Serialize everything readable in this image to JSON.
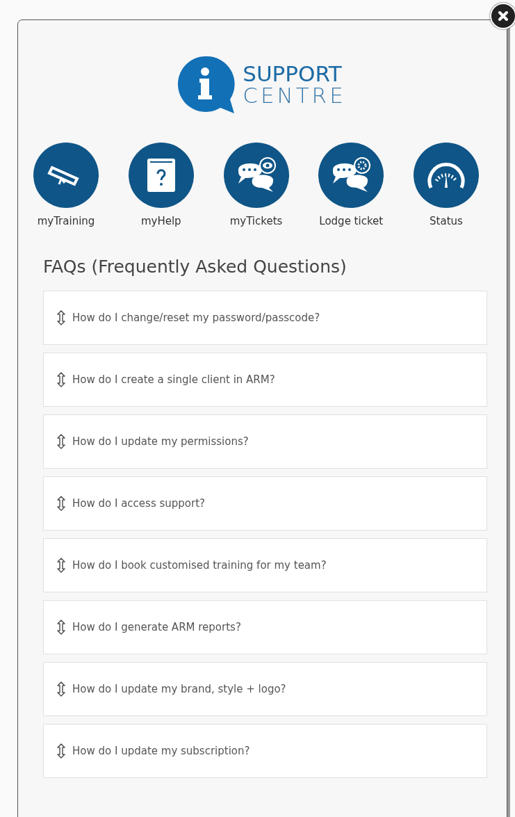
{
  "logo": {
    "line_1": "SUPPORT",
    "line_2": "CENTRE"
  },
  "shortcuts": [
    {
      "kind": "training",
      "label": "myTraining"
    },
    {
      "kind": "help",
      "label": "myHelp"
    },
    {
      "kind": "tickets",
      "label": "myTickets"
    },
    {
      "kind": "lodge",
      "label": "Lodge ticket"
    },
    {
      "kind": "status",
      "label": "Status"
    }
  ],
  "faq": {
    "title": "FAQs (Frequently Asked Questions)",
    "items": [
      "How do I change/reset my password/passcode?",
      "How do I create a single client in ARM?",
      "How do I update my permissions?",
      "How do I access support?",
      "How do I book customised training for my team?",
      "How do I generate ARM reports?",
      "How do I update my brand, style + logo?",
      "How do I update my subscription?"
    ]
  }
}
